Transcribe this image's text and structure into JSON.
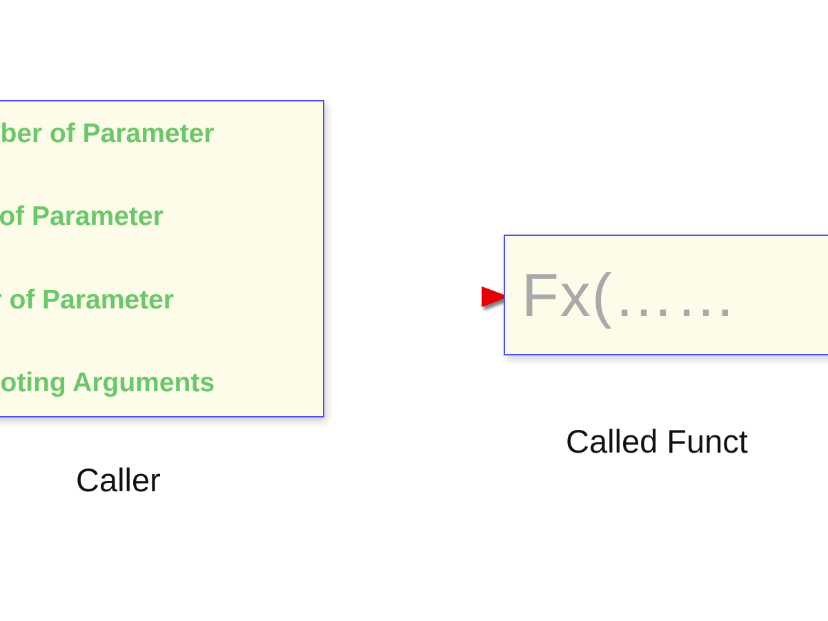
{
  "caller": {
    "lines": [
      "umber of Parameter",
      "pe of Parameter",
      "der of Parameter",
      "omoting Arguments"
    ],
    "label": "Caller"
  },
  "called": {
    "fx": "Fx(……",
    "label": "Called Funct"
  },
  "colors": {
    "box_border": "#4a4aff",
    "box_fill": "#fcfce8",
    "param_text": "#6ac76a",
    "fx_text": "#a9a9a9",
    "arrow": "#e60000"
  }
}
